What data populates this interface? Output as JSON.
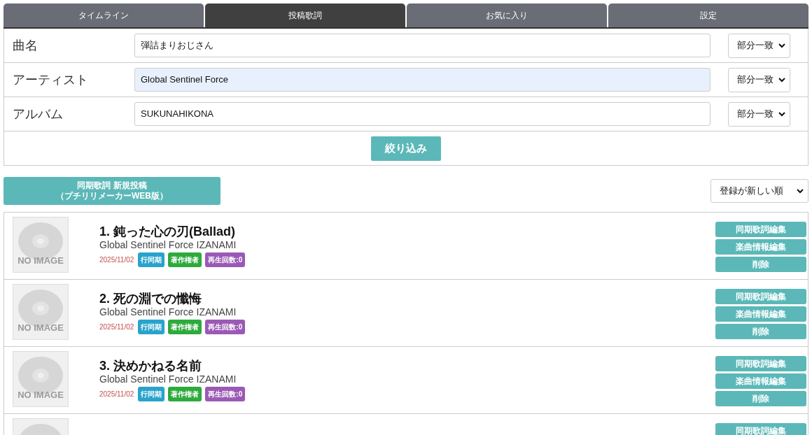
{
  "tabs": [
    {
      "label": "タイムライン",
      "selected": false
    },
    {
      "label": "投稿歌詞",
      "selected": true
    },
    {
      "label": "お気に入り",
      "selected": false
    },
    {
      "label": "設定",
      "selected": false
    }
  ],
  "filter": {
    "fields": [
      {
        "label": "曲名",
        "value": "弾詰まりおじさん",
        "autofilled": false,
        "match": "部分一致"
      },
      {
        "label": "アーティスト",
        "value": "Global Sentinel Force",
        "autofilled": true,
        "match": "部分一致"
      },
      {
        "label": "アルバム",
        "value": "SUKUNAHIKONA",
        "autofilled": false,
        "match": "部分一致"
      }
    ],
    "submit": "絞り込み"
  },
  "new_post_button": [
    "同期歌詞 新規投稿",
    "（プチリリメーカーWEB版）"
  ],
  "sort": "登録が新しい順",
  "songs": [
    {
      "title": "1. 鈍った心の刃(Ballad)",
      "artist": "Global Sentinel Force IZANAMI",
      "thumbnail": "NO IMAGE",
      "date": "2025/11/02",
      "badges": [
        {
          "text": "行同期",
          "color": "#29a3cc"
        },
        {
          "text": "著作権者",
          "color": "#2eaa3d"
        },
        {
          "text": "再生回数:0",
          "color": "#9b59b6"
        }
      ],
      "actions": [
        "同期歌詞編集",
        "楽曲情報編集",
        "削除"
      ]
    },
    {
      "title": "2. 死の淵での懺悔",
      "artist": "Global Sentinel Force IZANAMI",
      "thumbnail": "NO IMAGE",
      "date": "2025/11/02",
      "badges": [
        {
          "text": "行同期",
          "color": "#29a3cc"
        },
        {
          "text": "著作権者",
          "color": "#2eaa3d"
        },
        {
          "text": "再生回数:0",
          "color": "#9b59b6"
        }
      ],
      "actions": [
        "同期歌詞編集",
        "楽曲情報編集",
        "削除"
      ]
    },
    {
      "title": "3. 決めかねる名前",
      "artist": "Global Sentinel Force IZANAMI",
      "thumbnail": "NO IMAGE",
      "date": "2025/11/02",
      "badges": [
        {
          "text": "行同期",
          "color": "#29a3cc"
        },
        {
          "text": "著作権者",
          "color": "#2eaa3d"
        },
        {
          "text": "再生回数:0",
          "color": "#9b59b6"
        }
      ],
      "actions": [
        "同期歌詞編集",
        "楽曲情報編集",
        "削除"
      ]
    },
    {
      "actions": [
        "同期歌詞編集"
      ]
    }
  ]
}
